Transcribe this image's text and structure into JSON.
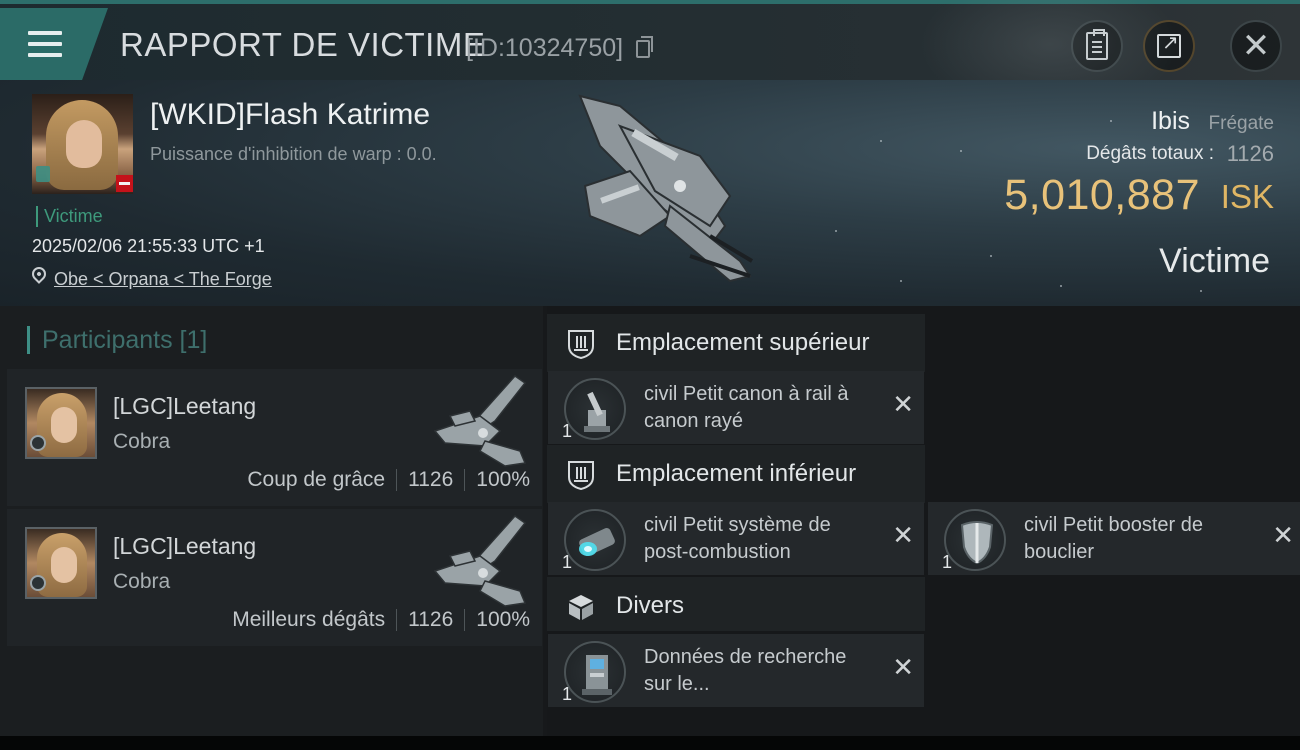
{
  "header": {
    "title": "RAPPORT DE VICTIME",
    "report_id": "[ID:10324750]",
    "icons": [
      "menu-icon",
      "copy-icon",
      "clipboard-icon",
      "share-icon",
      "close-icon"
    ]
  },
  "victim": {
    "name": "[WKID]Flash Katrime",
    "warp_disruption": "Puissance d'inhibition de warp : 0.0.",
    "role_tag": "Victime",
    "timestamp": "2025/02/06 21:55:33 UTC +1",
    "location": "Obe < Orpana < The Forge",
    "ship_name": "Ibis",
    "ship_class": "Frégate",
    "damage_label": "Dégâts totaux :",
    "damage_value": "1126",
    "isk_value": "5,010,887",
    "isk_unit": "ISK",
    "status": "Victime"
  },
  "participants": {
    "title": "Participants [1]",
    "items": [
      {
        "name": "[LGC]Leetang",
        "ship": "Cobra",
        "role": "Coup de grâce",
        "damage": "1126",
        "percent": "100%"
      },
      {
        "name": "[LGC]Leetang",
        "ship": "Cobra",
        "role": "Meilleurs dégâts",
        "damage": "1126",
        "percent": "100%"
      }
    ]
  },
  "fitting": {
    "high_slot": {
      "title": "Emplacement supérieur",
      "modules": [
        {
          "name": "civil Petit canon à rail à canon rayé",
          "qty": "1"
        }
      ]
    },
    "low_slot": {
      "title": "Emplacement inférieur",
      "modules": [
        {
          "name": "civil Petit système de post-combustion",
          "qty": "1"
        },
        {
          "name": "civil Petit booster de bouclier",
          "qty": "1"
        }
      ]
    },
    "misc": {
      "title": "Divers",
      "modules": [
        {
          "name": "Données de recherche sur le...",
          "qty": "1"
        }
      ]
    }
  },
  "colors": {
    "accent_teal": "#2b6b67",
    "isk_gold": "#e8c27a",
    "victim_green": "#3e9a7c",
    "security_red": "#c4121a"
  }
}
